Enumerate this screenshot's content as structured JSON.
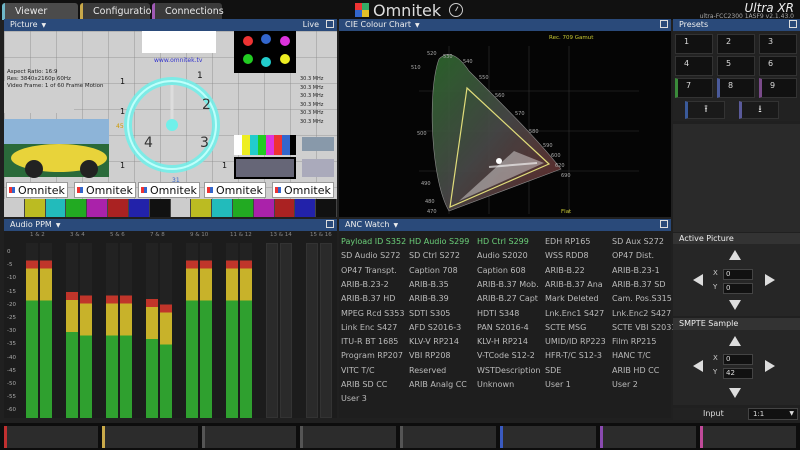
{
  "tabs": [
    "Viewer",
    "Configuration",
    "Connections"
  ],
  "app": {
    "logo_text": "Omnitek",
    "brand": "Ultra XR",
    "version": "ultra-FCC2300 1ASF9 v2.1.43.0"
  },
  "picture": {
    "header": "Picture",
    "live": "Live",
    "url": "www.omnitek.tv",
    "info": [
      "Aspect Ratio: 16:9",
      "Res: 3840x2160p 60Hz",
      "Video Frame: 1 of 60   Frame Motion"
    ],
    "logo_text": "Omnitek",
    "clock_numbers": [
      "1",
      "2",
      "3",
      "4"
    ],
    "side_numbers": [
      "1",
      "1",
      "1",
      "1"
    ],
    "small_labels": [
      "45",
      "31"
    ],
    "freq_labels": [
      "30.3 MHz",
      "30.3 MHz",
      "30.3 MHz",
      "30.3 MHz",
      "30.3 MHz",
      "30.3 MHz"
    ]
  },
  "cie": {
    "header": "CIE Colour Chart",
    "gamut": "Rec. 709 Gamut",
    "flat": "Flat",
    "wavelengths": [
      "520",
      "530",
      "540",
      "510",
      "550",
      "560",
      "570",
      "580",
      "590",
      "600",
      "620",
      "690",
      "500",
      "490",
      "480",
      "470"
    ]
  },
  "ppm": {
    "header": "Audio PPM",
    "channel_labels": [
      "1 & 2",
      "3 & 4",
      "5 & 6",
      "7 & 8",
      "9 & 10",
      "11 & 12",
      "13 & 14",
      "15 & 16"
    ],
    "scale": [
      "0",
      "-5",
      "-10",
      "-15",
      "-20",
      "-25",
      "-30",
      "-35",
      "-40",
      "-45",
      "-50",
      "-55",
      "-60"
    ]
  },
  "anc": {
    "header": "ANC Watch",
    "rows": [
      [
        "Payload ID S352",
        "HD Audio S299",
        "HD Ctrl S299",
        "EDH RP165",
        "SD Aux S272"
      ],
      [
        "SD Audio S272",
        "SD Ctrl S272",
        "Audio S2020",
        "WSS RDD8",
        "OP47 Dist."
      ],
      [
        "OP47 Transpt.",
        "Caption 708",
        "Caption 608",
        "ARIB-B.22",
        "ARIB-B.23-1"
      ],
      [
        "ARIB-B.23-2",
        "ARIB-B.35",
        "ARIB-B.37 Mob.",
        "ARIB-B.37 Ana",
        "ARIB-B.37 SD"
      ],
      [
        "ARIB-B.37 HD",
        "ARIB-B.39",
        "ARIB-B.27 Capt",
        "Mark Deleted",
        "Cam. Pos.S315"
      ],
      [
        "MPEG Rcd S353",
        "SDTI S305",
        "HDTI S348",
        "Lnk.Enc1 S427",
        "Lnk.Enc2 S427"
      ],
      [
        "Link Enc S427",
        "AFD S2016-3",
        "PAN S2016-4",
        "SCTE MSG",
        "SCTE VBI S2031"
      ],
      [
        "ITU-R BT 1685",
        "KLV-V RP214",
        "KLV-H RP214",
        "UMID/ID RP223",
        "Film RP215"
      ],
      [
        "Program RP207",
        "VBI RP208",
        "V-TCode S12-2",
        "HFR-T/C S12-3",
        "HANC T/C"
      ],
      [
        "VITC T/C",
        "Reserved",
        "WSTDescription",
        "SDE",
        "ARIB HD CC"
      ],
      [
        "ARIB SD CC",
        "ARIB Analg CC",
        "Unknown",
        "User 1",
        "User 2"
      ],
      [
        "User 3",
        "",
        "",
        "",
        ""
      ]
    ]
  },
  "presets": {
    "header": "Presets",
    "buttons": [
      "1",
      "2",
      "3",
      "4",
      "5",
      "6",
      "7",
      "8",
      "9"
    ]
  },
  "active_picture": {
    "header": "Active Picture",
    "x_label": "X",
    "y_label": "Y",
    "x": "0",
    "y": "0"
  },
  "smpte": {
    "header": "SMPTE Sample",
    "x_label": "X",
    "y_label": "Y",
    "x": "0",
    "y": "42"
  },
  "input": {
    "label": "Input",
    "value": "1:1"
  },
  "colors": {
    "header_blue": "#2a4a7a",
    "active_green": "#6cd07a",
    "meter_green": "#2fa02f",
    "meter_yellow": "#c8b22a",
    "meter_red": "#c0352a"
  }
}
